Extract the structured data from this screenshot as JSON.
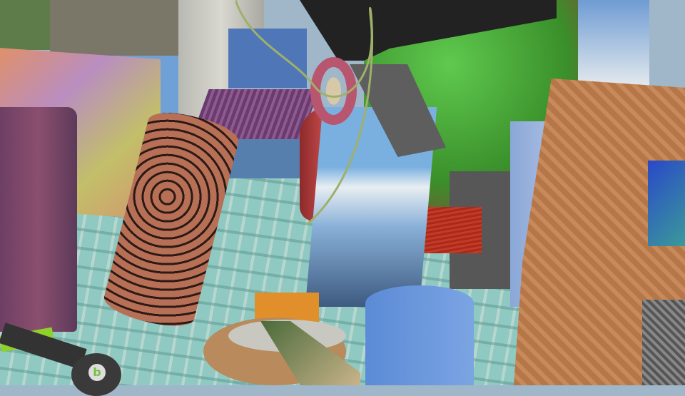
{
  "scene": {
    "kind": "synthetic 3D render of textured objects on a tiled floor",
    "colors": {
      "floor": "#9fcfc6",
      "green_vase": "#3a8f2a",
      "blue_cylinder": "#5b8bd6",
      "orange_block": "#e08f2a",
      "red_block": "#c63a26",
      "wood_board": "#b57648"
    },
    "logo_text": "b"
  }
}
